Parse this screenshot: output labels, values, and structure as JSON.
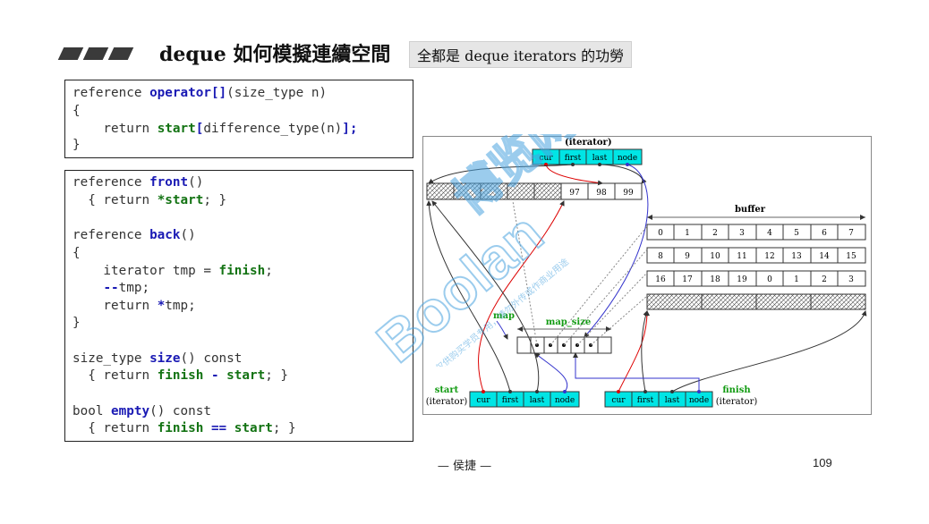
{
  "header": {
    "title": "deque 如何模擬連續空間",
    "subtitle": "全都是 deque iterators 的功勞"
  },
  "code1": {
    "l1a": "reference ",
    "l1b": "operator[]",
    "l1c": "(size_type n)",
    "l2": "{",
    "l3a": "    return ",
    "l3b": "start",
    "l3c": "[",
    "l3d": "difference_type(n)",
    "l3e": "];",
    "l4": "}"
  },
  "code2": {
    "front_a": "reference ",
    "front_b": "front",
    "front_c": "()",
    "front2_a": "  { return ",
    "front2_b": "*start",
    "front2_c": "; }",
    "back_a": "reference ",
    "back_b": "back",
    "back_c": "()",
    "back2": "{",
    "back3_a": "    iterator tmp = ",
    "back3_b": "finish",
    "back3_c": ";",
    "back4_a": "    ",
    "back4_b": "--",
    "back4_c": "tmp;",
    "back5_a": "    return ",
    "back5_b": "*",
    "back5_c": "tmp;",
    "back6": "}",
    "size_a": "size_type ",
    "size_b": "size",
    "size_c": "() const",
    "size2_a": "  { return ",
    "size2_b": "finish",
    "size2_c": " - ",
    "size2_d": "start",
    "size2_e": "; }",
    "empty_a": "bool ",
    "empty_b": "empty",
    "empty_c": "() const",
    "empty2_a": "  { return ",
    "empty2_b": "finish",
    "empty2_c": " == ",
    "empty2_d": "start",
    "empty2_e": "; }"
  },
  "diagram": {
    "iterator_label": "(iterator)",
    "iter_fields": [
      "cur",
      "first",
      "last",
      "node"
    ],
    "top_buffer_values": [
      "97",
      "98",
      "99"
    ],
    "buffer_label": "buffer",
    "row1": [
      "0",
      "1",
      "2",
      "3",
      "4",
      "5",
      "6",
      "7"
    ],
    "row2": [
      "8",
      "9",
      "10",
      "11",
      "12",
      "13",
      "14",
      "15"
    ],
    "row3": [
      "16",
      "17",
      "18",
      "19",
      "0",
      "1",
      "2",
      "3"
    ],
    "map_label": "map",
    "map_size_label": "map_size",
    "start_label": "start",
    "start_sub": "(iterator)",
    "finish_label": "finish",
    "finish_sub": "(iterator)"
  },
  "watermark": {
    "brand": "Boolan",
    "cn": "博览网",
    "note": "本讲义仅供购买学员专用，请勿外传或作商业用途",
    "color": "#4aa3df"
  },
  "footer": {
    "author": "— 侯捷 —",
    "page": "109"
  }
}
